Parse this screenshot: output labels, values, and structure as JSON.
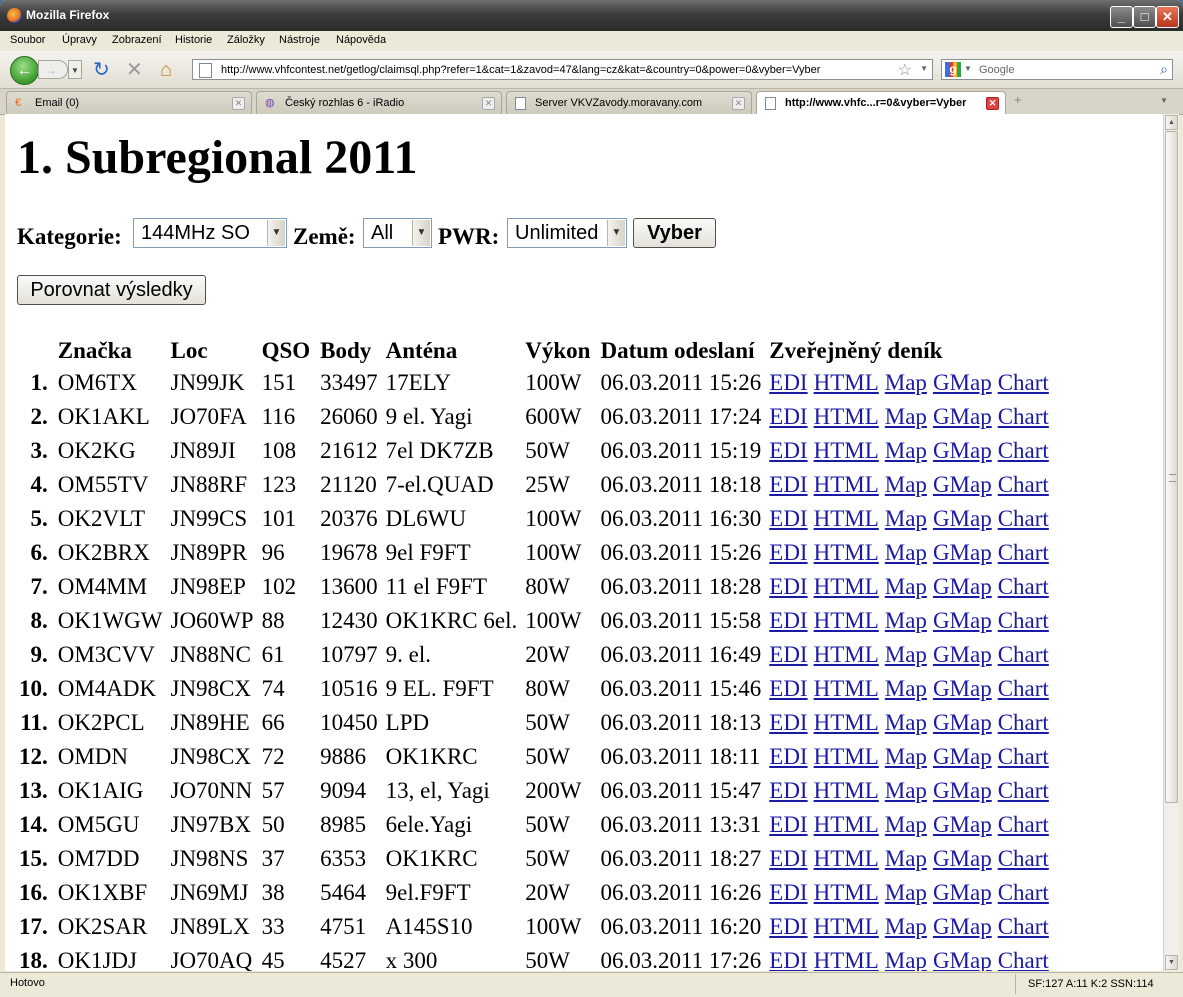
{
  "window": {
    "title": "Mozilla Firefox"
  },
  "menu": [
    "Soubor",
    "Úpravy",
    "Zobrazení",
    "Historie",
    "Záložky",
    "Nástroje",
    "Nápověda"
  ],
  "nav": {
    "url": "http://www.vhfcontest.net/getlog/claimsql.php?refer=1&cat=1&zavod=47&lang=cz&kat=&country=0&power=0&vyber=Vyber",
    "search_placeholder": "Google"
  },
  "tabs": [
    {
      "label": "Email (0)",
      "icon": "email-icon",
      "active": false
    },
    {
      "label": "Český rozhlas 6 - iRadio",
      "icon": "radio-icon",
      "active": false
    },
    {
      "label": "Server VKVZavody.moravany.com",
      "icon": "page-icon",
      "active": false
    },
    {
      "label": "http://www.vhfc...r=0&vyber=Vyber",
      "icon": "page-icon",
      "active": true
    }
  ],
  "page": {
    "title": "1. Subregional 2011",
    "form": {
      "category_label": "Kategorie:",
      "category_value": "144MHz SO",
      "country_label": "Země:",
      "country_value": "All",
      "power_label": "PWR:",
      "power_value": "Unlimited",
      "select_button": "Vyber",
      "compare_button": "Porovnat výsledky"
    },
    "columns": [
      "Značka",
      "Loc",
      "QSO",
      "Body",
      "Anténa",
      "Výkon",
      "Datum odeslaní",
      "Zveřejněný deník"
    ],
    "link_labels": [
      "EDI",
      "HTML",
      "Map",
      "GMap",
      "Chart"
    ],
    "rows": [
      {
        "rank": "1.",
        "call": "OM6TX",
        "loc": "JN99JK",
        "qso": "151",
        "body": "33497",
        "antenna": "17ELY",
        "power": "100W",
        "date": "06.03.2011 15:26"
      },
      {
        "rank": "2.",
        "call": "OK1AKL",
        "loc": "JO70FA",
        "qso": "116",
        "body": "26060",
        "antenna": "9 el. Yagi",
        "power": "600W",
        "date": "06.03.2011 17:24"
      },
      {
        "rank": "3.",
        "call": "OK2KG",
        "loc": "JN89JI",
        "qso": "108",
        "body": "21612",
        "antenna": "7el DK7ZB",
        "power": "50W",
        "date": "06.03.2011 15:19"
      },
      {
        "rank": "4.",
        "call": "OM55TV",
        "loc": "JN88RF",
        "qso": "123",
        "body": "21120",
        "antenna": "7-el.QUAD",
        "power": "25W",
        "date": "06.03.2011 18:18"
      },
      {
        "rank": "5.",
        "call": "OK2VLT",
        "loc": "JN99CS",
        "qso": "101",
        "body": "20376",
        "antenna": "DL6WU",
        "power": "100W",
        "date": "06.03.2011 16:30"
      },
      {
        "rank": "6.",
        "call": "OK2BRX",
        "loc": "JN89PR",
        "qso": "96",
        "body": "19678",
        "antenna": "9el F9FT",
        "power": "100W",
        "date": "06.03.2011 15:26"
      },
      {
        "rank": "7.",
        "call": "OM4MM",
        "loc": "JN98EP",
        "qso": "102",
        "body": "13600",
        "antenna": "11 el F9FT",
        "power": "80W",
        "date": "06.03.2011 18:28"
      },
      {
        "rank": "8.",
        "call": "OK1WGW",
        "loc": "JO60WP",
        "qso": "88",
        "body": "12430",
        "antenna": "OK1KRC 6el.",
        "power": "100W",
        "date": "06.03.2011 15:58"
      },
      {
        "rank": "9.",
        "call": "OM3CVV",
        "loc": "JN88NC",
        "qso": "61",
        "body": "10797",
        "antenna": "9. el.",
        "power": "20W",
        "date": "06.03.2011 16:49"
      },
      {
        "rank": "10.",
        "call": "OM4ADK",
        "loc": "JN98CX",
        "qso": "74",
        "body": "10516",
        "antenna": "9 EL. F9FT",
        "power": "80W",
        "date": "06.03.2011 15:46"
      },
      {
        "rank": "11.",
        "call": "OK2PCL",
        "loc": "JN89HE",
        "qso": "66",
        "body": "10450",
        "antenna": "LPD",
        "power": "50W",
        "date": "06.03.2011 18:13"
      },
      {
        "rank": "12.",
        "call": "OMDN",
        "loc": "JN98CX",
        "qso": "72",
        "body": "9886",
        "antenna": "OK1KRC",
        "power": "50W",
        "date": "06.03.2011 18:11"
      },
      {
        "rank": "13.",
        "call": "OK1AIG",
        "loc": "JO70NN",
        "qso": "57",
        "body": "9094",
        "antenna": "13, el, Yagi",
        "power": "200W",
        "date": "06.03.2011 15:47"
      },
      {
        "rank": "14.",
        "call": "OM5GU",
        "loc": "JN97BX",
        "qso": "50",
        "body": "8985",
        "antenna": "6ele.Yagi",
        "power": "50W",
        "date": "06.03.2011 13:31"
      },
      {
        "rank": "15.",
        "call": "OM7DD",
        "loc": "JN98NS",
        "qso": "37",
        "body": "6353",
        "antenna": "OK1KRC",
        "power": "50W",
        "date": "06.03.2011 18:27"
      },
      {
        "rank": "16.",
        "call": "OK1XBF",
        "loc": "JN69MJ",
        "qso": "38",
        "body": "5464",
        "antenna": "9el.F9FT",
        "power": "20W",
        "date": "06.03.2011 16:26"
      },
      {
        "rank": "17.",
        "call": "OK2SAR",
        "loc": "JN89LX",
        "qso": "33",
        "body": "4751",
        "antenna": "A145S10",
        "power": "100W",
        "date": "06.03.2011 16:20"
      },
      {
        "rank": "18.",
        "call": "OK1JDJ",
        "loc": "JO70AQ",
        "qso": "45",
        "body": "4527",
        "antenna": "x 300",
        "power": "50W",
        "date": "06.03.2011 17:26"
      }
    ]
  },
  "status": {
    "text": "Hotovo",
    "stats": "SF:127 A:11 K:2 SSN:114"
  },
  "colors": {
    "link": "#1a1aa6",
    "titlebar": "#3c3c3c"
  }
}
